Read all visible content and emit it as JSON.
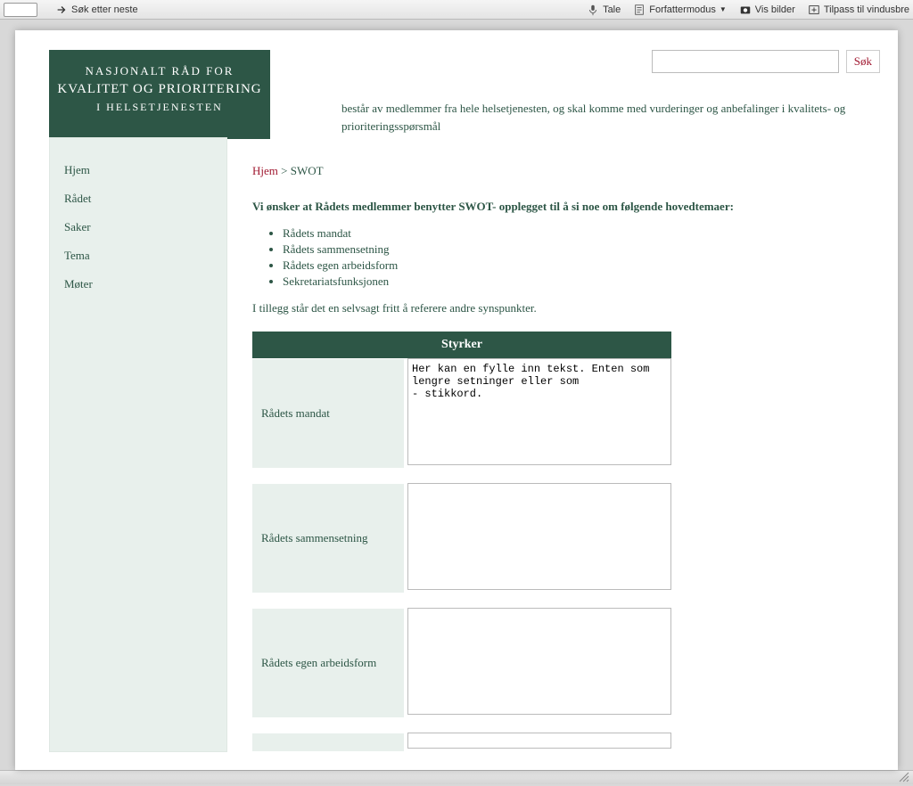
{
  "toolbar": {
    "search_next": "Søk etter neste",
    "tale": "Tale",
    "forfattermodus": "Forfattermodus",
    "vis_bilder": "Vis bilder",
    "tilpass": "Tilpass til vindusbre"
  },
  "logo": {
    "line1": "NASJONALT RÅD FOR",
    "line2": "KVALITET OG PRIORITERING",
    "line3": "I HELSETJENESTEN"
  },
  "search": {
    "button": "Søk",
    "value": ""
  },
  "tagline": "består av medlemmer fra hele helsetjenesten, og skal komme med vurderinger og anbefalinger i kvalitets- og prioriteringsspørsmål",
  "sidebar": {
    "items": [
      "Hjem",
      "Rådet",
      "Saker",
      "Tema",
      "Møter"
    ]
  },
  "breadcrumb": {
    "home": "Hjem",
    "sep": ">",
    "current": "SWOT"
  },
  "main": {
    "intro": "Vi ønsker at Rådets medlemmer benytter SWOT- opplegget til å si noe om følgende hovedtemaer:",
    "bullets": [
      "Rådets mandat",
      "Rådets sammensetning",
      "Rådets egen arbeidsform",
      "Sekretariatsfunksjonen"
    ],
    "footnote": "I tillegg står det en selvsagt fritt å referere andre synspunkter.",
    "table_header": "Styrker",
    "rows": [
      {
        "label": "Rådets mandat",
        "value": "Her kan en fylle inn tekst. Enten som lengre setninger eller som\n- stikkord."
      },
      {
        "label": "Rådets sammensetning",
        "value": ""
      },
      {
        "label": "Rådets egen arbeidsform",
        "value": ""
      }
    ]
  }
}
